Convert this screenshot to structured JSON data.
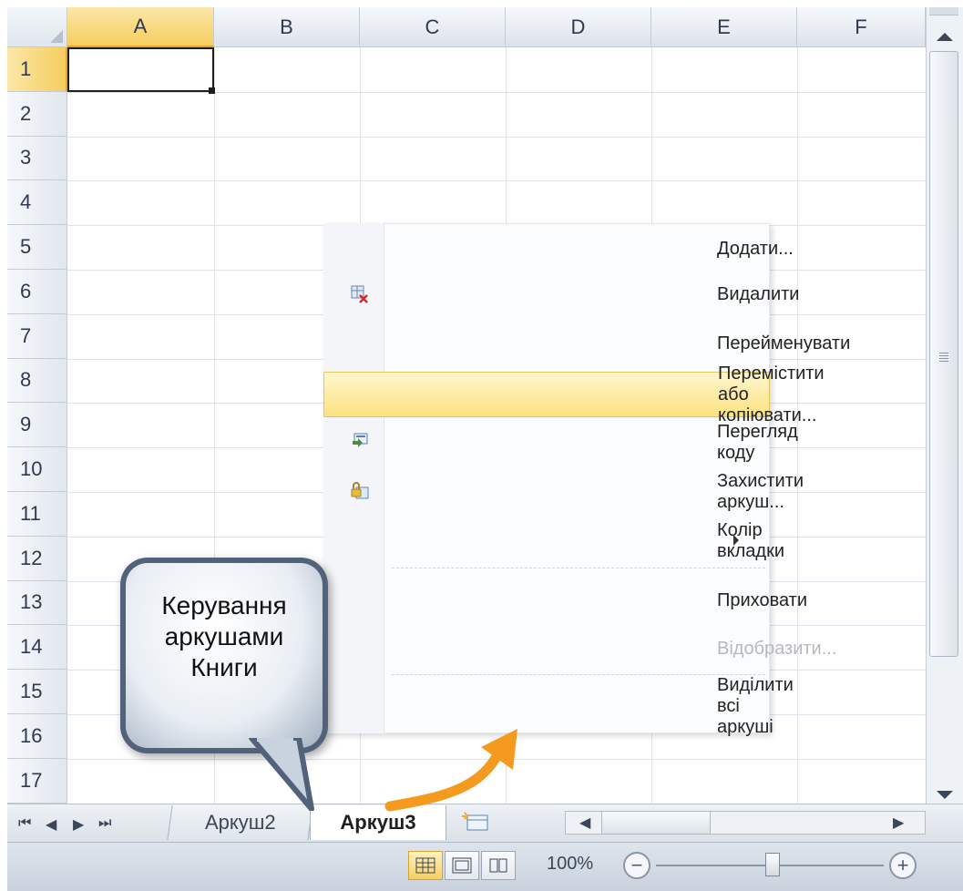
{
  "columns": [
    "A",
    "B",
    "C",
    "D",
    "E",
    "F"
  ],
  "rows": [
    "1",
    "2",
    "3",
    "4",
    "5",
    "6",
    "7",
    "8",
    "9",
    "10",
    "11",
    "12",
    "13",
    "14",
    "15",
    "16",
    "17"
  ],
  "context_menu": {
    "items": [
      {
        "label": "Додати...",
        "icon": "",
        "state": "normal"
      },
      {
        "label": "Видалити",
        "icon": "delete-sheet-icon",
        "state": "normal"
      },
      {
        "label": "Перейменувати",
        "icon": "",
        "state": "normal"
      },
      {
        "label": "Перемістити або копіювати...",
        "icon": "",
        "state": "highlighted"
      },
      {
        "label": "Перегляд коду",
        "icon": "view-code-icon",
        "state": "normal"
      },
      {
        "label": "Захистити аркуш...",
        "icon": "protect-sheet-icon",
        "state": "normal"
      },
      {
        "label": "Колір вкладки",
        "icon": "",
        "state": "submenu"
      },
      {
        "label": "Приховати",
        "icon": "",
        "state": "normal"
      },
      {
        "label": "Відобразити...",
        "icon": "",
        "state": "disabled"
      },
      {
        "label": "Виділити всі аркуші",
        "icon": "",
        "state": "normal"
      }
    ]
  },
  "tabs": {
    "inactive": "Аркуш2",
    "active": "Аркуш3"
  },
  "status": {
    "zoom": "100%",
    "zoom_out": "−",
    "zoom_in": "+"
  },
  "callout": {
    "line1": "Керування",
    "line2": "аркушами",
    "line3": "Книги"
  },
  "colors": {
    "selected_header": "#f7cd5f",
    "highlight": "#fbe27f",
    "arrow": "#f39a1f",
    "callout_border": "#51627a"
  }
}
